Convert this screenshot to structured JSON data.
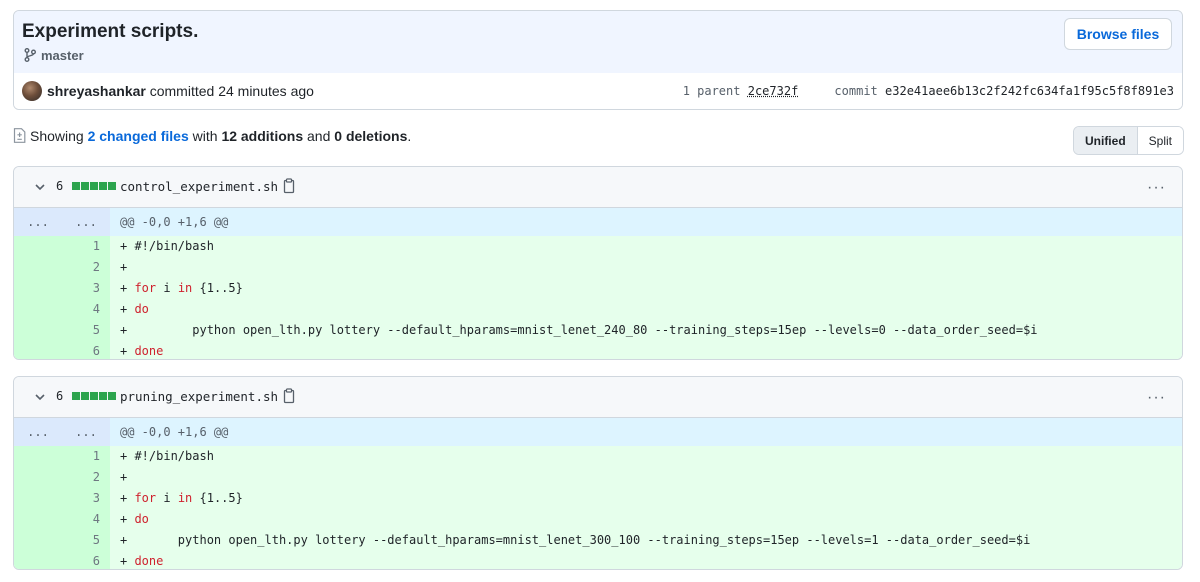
{
  "commit": {
    "title": "Experiment scripts.",
    "branch": "master",
    "browse_label": "Browse files",
    "author": "shreyashankar",
    "committed_text": "committed 24 minutes ago",
    "parent_label": "1 parent",
    "parent_hash": "2ce732f",
    "commit_label": "commit",
    "commit_hash": "e32e41aee6b13c2f242fc634fa1f95c5f8f891e3"
  },
  "summary": {
    "showing": "Showing",
    "changed_files": "2 changed files",
    "with": "with",
    "additions": "12 additions",
    "and": "and",
    "deletions": "0 deletions",
    "period": "."
  },
  "view_toggle": {
    "unified": "Unified",
    "split": "Split",
    "selected": "Unified"
  },
  "files": [
    {
      "count": "6",
      "name": "control_experiment.sh",
      "hunk": "@@ -0,0 +1,6 @@",
      "lines": [
        {
          "num": "1",
          "text": "+ #!/bin/bash"
        },
        {
          "num": "2",
          "text": "+"
        },
        {
          "num": "3",
          "text": "+ for i in {1..5}"
        },
        {
          "num": "4",
          "text": "+ do"
        },
        {
          "num": "5",
          "text": "+         python open_lth.py lottery --default_hparams=mnist_lenet_240_80 --training_steps=15ep --levels=0 --data_order_seed=$i"
        },
        {
          "num": "6",
          "text": "+ done"
        }
      ]
    },
    {
      "count": "6",
      "name": "pruning_experiment.sh",
      "hunk": "@@ -0,0 +1,6 @@",
      "lines": [
        {
          "num": "1",
          "text": "+ #!/bin/bash"
        },
        {
          "num": "2",
          "text": "+"
        },
        {
          "num": "3",
          "text": "+ for i in {1..5}"
        },
        {
          "num": "4",
          "text": "+ do"
        },
        {
          "num": "5",
          "text": "+       python open_lth.py lottery --default_hparams=mnist_lenet_300_100 --training_steps=15ep --levels=1 --data_order_seed=$i"
        },
        {
          "num": "6",
          "text": "+ done"
        }
      ]
    }
  ],
  "hunk_expand": "...",
  "colors": {
    "addition_bg": "#e6ffec",
    "addition_gutter": "#ccffd8",
    "hunk_bg": "#ddf4ff",
    "link": "#0969da",
    "diffstat_green": "#2da44e"
  },
  "icons": [
    "git-branch-icon",
    "file-diff-icon",
    "chevron-down-icon",
    "copy-icon",
    "kebab-horizontal-icon"
  ]
}
